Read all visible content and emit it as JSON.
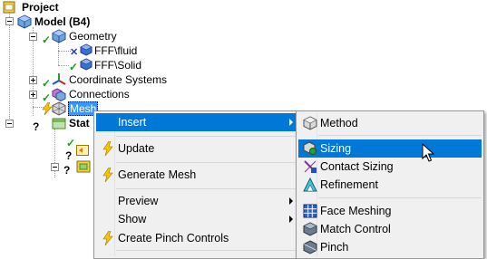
{
  "tree": {
    "project": "Project",
    "model": "Model (B4)",
    "geometry": "Geometry",
    "fluid": "FFF\\fluid",
    "solid": "FFF\\Solid",
    "coordinate_systems": "Coordinate Systems",
    "connections": "Connections",
    "mesh": "Mesh",
    "static_partial": "Stat"
  },
  "context_menu": {
    "insert": "Insert",
    "update": "Update",
    "generate_mesh": "Generate Mesh",
    "preview": "Preview",
    "show": "Show",
    "create_pinch_controls": "Create Pinch Controls"
  },
  "submenu": {
    "method": "Method",
    "sizing": "Sizing",
    "contact_sizing": "Contact Sizing",
    "refinement": "Refinement",
    "face_meshing": "Face Meshing",
    "match_control": "Match Control",
    "pinch": "Pinch"
  },
  "colors": {
    "highlight": "#0078d7",
    "menu_bg": "#f0f0f0",
    "check_green": "#1b9e1b"
  }
}
